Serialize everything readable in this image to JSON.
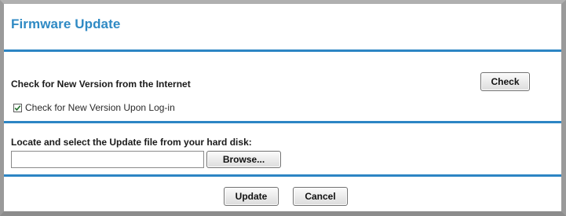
{
  "header": {
    "title": "Firmware Update"
  },
  "online_check": {
    "label": "Check for New Version from the Internet",
    "check_button": "Check",
    "login_check_label": "Check for New Version Upon Log-in",
    "login_check_checked": true
  },
  "local_file": {
    "label": "Locate and select the Update file from your hard disk:",
    "file_value": "",
    "browse_button": "Browse..."
  },
  "actions": {
    "update_button": "Update",
    "cancel_button": "Cancel"
  },
  "colors": {
    "title": "#2f8ac4",
    "divider": "#2c85c4",
    "frame": "#9a9a9a"
  },
  "icons": {
    "checkbox": "checkmark-icon"
  }
}
